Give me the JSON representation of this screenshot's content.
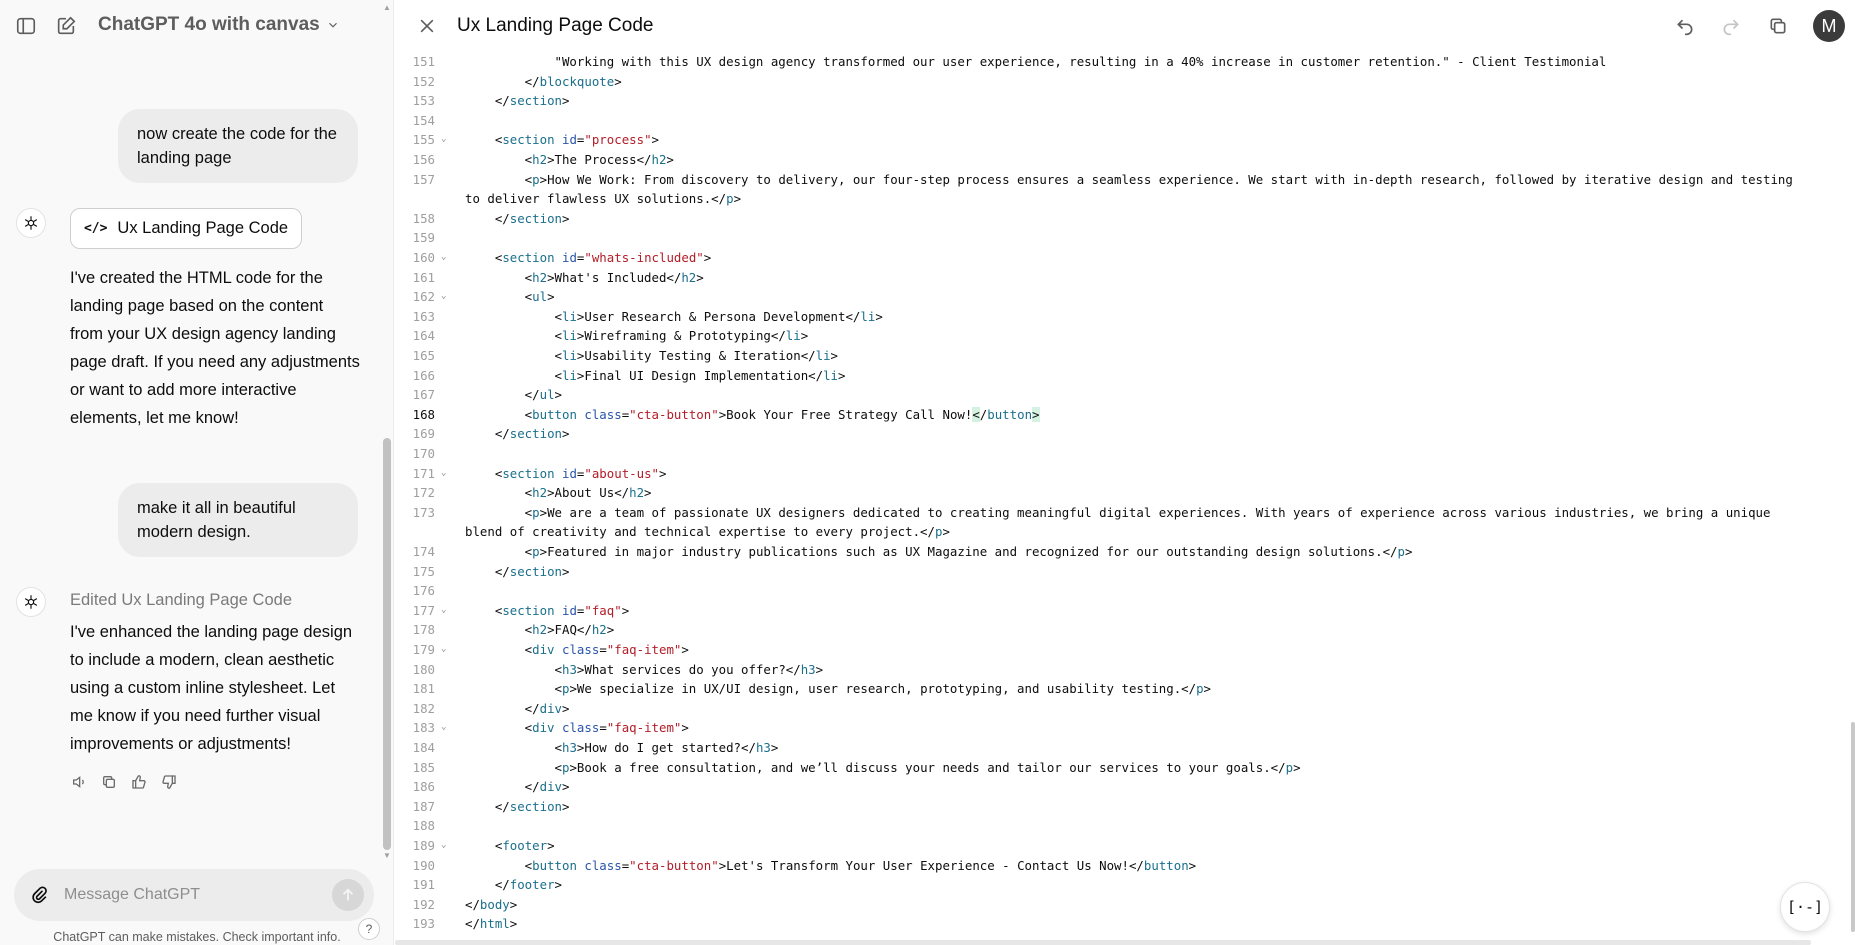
{
  "sidebar": {
    "model_name": "ChatGPT 4o with canvas",
    "icons": {
      "toggle": "sidebar-toggle-icon",
      "new_chat": "new-chat-icon"
    }
  },
  "conversation": {
    "user_message_1": "now create the code for the landing page",
    "canvas_chip_label": "Ux Landing Page Code",
    "assistant_message_1": "I've created the HTML code for the landing page based on the content from your UX design agency landing page draft. If you need any adjustments or want to add more interactive elements, let me know!",
    "user_message_2": "make it all in beautiful modern design.",
    "edited_label": "Edited Ux Landing Page Code",
    "assistant_message_2": "I've enhanced the landing page design to include a modern, clean aesthetic using a custom inline stylesheet. Let me know if you need further visual improvements or adjustments!"
  },
  "composer": {
    "placeholder": "Message ChatGPT",
    "disclaimer": "ChatGPT can make mistakes. Check important info.",
    "help_label": "?"
  },
  "canvas": {
    "title": "Ux Landing Page Code",
    "avatar_initial": "M",
    "format_button_label": "[·-]"
  },
  "code": {
    "active_line": 168,
    "lines": [
      {
        "n": "151",
        "fold": false,
        "html": "            \"Working with this UX design agency transformed our user experience, resulting in a 40% increase in customer retention.\" - Client Testimonial"
      },
      {
        "n": "152",
        "fold": false,
        "html": "        &lt;/<span class=\"t\">blockquote</span>&gt;"
      },
      {
        "n": "153",
        "fold": false,
        "html": "    &lt;/<span class=\"t\">section</span>&gt;"
      },
      {
        "n": "154",
        "fold": false,
        "html": ""
      },
      {
        "n": "155",
        "fold": true,
        "html": "    &lt;<span class=\"t\">section</span> <span class=\"a\">id</span>=<span class=\"s\">\"process\"</span>&gt;"
      },
      {
        "n": "156",
        "fold": false,
        "html": "        &lt;<span class=\"t\">h2</span>&gt;The Process&lt;/<span class=\"t\">h2</span>&gt;"
      },
      {
        "n": "157",
        "fold": false,
        "html": "        &lt;<span class=\"t\">p</span>&gt;How We Work: From discovery to delivery, our four-step process ensures a seamless experience. We start with in-depth research, followed by iterative design and testing"
      },
      {
        "n": "",
        "fold": false,
        "html": "to deliver flawless UX solutions.&lt;/<span class=\"t\">p</span>&gt;"
      },
      {
        "n": "158",
        "fold": false,
        "html": "    &lt;/<span class=\"t\">section</span>&gt;"
      },
      {
        "n": "159",
        "fold": false,
        "html": ""
      },
      {
        "n": "160",
        "fold": true,
        "html": "    &lt;<span class=\"t\">section</span> <span class=\"a\">id</span>=<span class=\"s\">\"whats-included\"</span>&gt;"
      },
      {
        "n": "161",
        "fold": false,
        "html": "        &lt;<span class=\"t\">h2</span>&gt;What's Included&lt;/<span class=\"t\">h2</span>&gt;"
      },
      {
        "n": "162",
        "fold": true,
        "html": "        &lt;<span class=\"t\">ul</span>&gt;"
      },
      {
        "n": "163",
        "fold": false,
        "html": "            &lt;<span class=\"t\">li</span>&gt;User Research &amp; Persona Development&lt;/<span class=\"t\">li</span>&gt;"
      },
      {
        "n": "164",
        "fold": false,
        "html": "            &lt;<span class=\"t\">li</span>&gt;Wireframing &amp; Prototyping&lt;/<span class=\"t\">li</span>&gt;"
      },
      {
        "n": "165",
        "fold": false,
        "html": "            &lt;<span class=\"t\">li</span>&gt;Usability Testing &amp; Iteration&lt;/<span class=\"t\">li</span>&gt;"
      },
      {
        "n": "166",
        "fold": false,
        "html": "            &lt;<span class=\"t\">li</span>&gt;Final UI Design Implementation&lt;/<span class=\"t\">li</span>&gt;"
      },
      {
        "n": "167",
        "fold": false,
        "html": "        &lt;/<span class=\"t\">ul</span>&gt;"
      },
      {
        "n": "168",
        "fold": false,
        "html": "        &lt;<span class=\"t\">button</span> <span class=\"a\">class</span>=<span class=\"s\">\"cta-button\"</span>&gt;Book Your Free Strategy Call Now!<span class=\"hl\">&lt;</span>/<span class=\"t\">button</span><span class=\"hl\">&gt;</span>"
      },
      {
        "n": "169",
        "fold": false,
        "html": "    &lt;/<span class=\"t\">section</span>&gt;"
      },
      {
        "n": "170",
        "fold": false,
        "html": ""
      },
      {
        "n": "171",
        "fold": true,
        "html": "    &lt;<span class=\"t\">section</span> <span class=\"a\">id</span>=<span class=\"s\">\"about-us\"</span>&gt;"
      },
      {
        "n": "172",
        "fold": false,
        "html": "        &lt;<span class=\"t\">h2</span>&gt;About Us&lt;/<span class=\"t\">h2</span>&gt;"
      },
      {
        "n": "173",
        "fold": false,
        "html": "        &lt;<span class=\"t\">p</span>&gt;We are a team of passionate UX designers dedicated to creating meaningful digital experiences. With years of experience across various industries, we bring a unique"
      },
      {
        "n": "",
        "fold": false,
        "html": "blend of creativity and technical expertise to every project.&lt;/<span class=\"t\">p</span>&gt;"
      },
      {
        "n": "174",
        "fold": false,
        "html": "        &lt;<span class=\"t\">p</span>&gt;Featured in major industry publications such as UX Magazine and recognized for our outstanding design solutions.&lt;/<span class=\"t\">p</span>&gt;"
      },
      {
        "n": "175",
        "fold": false,
        "html": "    &lt;/<span class=\"t\">section</span>&gt;"
      },
      {
        "n": "176",
        "fold": false,
        "html": ""
      },
      {
        "n": "177",
        "fold": true,
        "html": "    &lt;<span class=\"t\">section</span> <span class=\"a\">id</span>=<span class=\"s\">\"faq\"</span>&gt;"
      },
      {
        "n": "178",
        "fold": false,
        "html": "        &lt;<span class=\"t\">h2</span>&gt;FAQ&lt;/<span class=\"t\">h2</span>&gt;"
      },
      {
        "n": "179",
        "fold": true,
        "html": "        &lt;<span class=\"t\">div</span> <span class=\"a\">class</span>=<span class=\"s\">\"faq-item\"</span>&gt;"
      },
      {
        "n": "180",
        "fold": false,
        "html": "            &lt;<span class=\"t\">h3</span>&gt;What services do you offer?&lt;/<span class=\"t\">h3</span>&gt;"
      },
      {
        "n": "181",
        "fold": false,
        "html": "            &lt;<span class=\"t\">p</span>&gt;We specialize in UX/UI design, user research, prototyping, and usability testing.&lt;/<span class=\"t\">p</span>&gt;"
      },
      {
        "n": "182",
        "fold": false,
        "html": "        &lt;/<span class=\"t\">div</span>&gt;"
      },
      {
        "n": "183",
        "fold": true,
        "html": "        &lt;<span class=\"t\">div</span> <span class=\"a\">class</span>=<span class=\"s\">\"faq-item\"</span>&gt;"
      },
      {
        "n": "184",
        "fold": false,
        "html": "            &lt;<span class=\"t\">h3</span>&gt;How do I get started?&lt;/<span class=\"t\">h3</span>&gt;"
      },
      {
        "n": "185",
        "fold": false,
        "html": "            &lt;<span class=\"t\">p</span>&gt;Book a free consultation, and we’ll discuss your needs and tailor our services to your goals.&lt;/<span class=\"t\">p</span>&gt;"
      },
      {
        "n": "186",
        "fold": false,
        "html": "        &lt;/<span class=\"t\">div</span>&gt;"
      },
      {
        "n": "187",
        "fold": false,
        "html": "    &lt;/<span class=\"t\">section</span>&gt;"
      },
      {
        "n": "188",
        "fold": false,
        "html": ""
      },
      {
        "n": "189",
        "fold": true,
        "html": "    &lt;<span class=\"t\">footer</span>&gt;"
      },
      {
        "n": "190",
        "fold": false,
        "html": "        &lt;<span class=\"t\">button</span> <span class=\"a\">class</span>=<span class=\"s\">\"cta-button\"</span>&gt;Let's Transform Your User Experience - Contact Us Now!&lt;/<span class=\"t\">button</span>&gt;"
      },
      {
        "n": "191",
        "fold": false,
        "html": "    &lt;/<span class=\"t\">footer</span>&gt;"
      },
      {
        "n": "192",
        "fold": false,
        "html": "&lt;/<span class=\"t\">body</span>&gt;"
      },
      {
        "n": "193",
        "fold": false,
        "html": "&lt;/<span class=\"t\">html</span>&gt;"
      }
    ]
  }
}
